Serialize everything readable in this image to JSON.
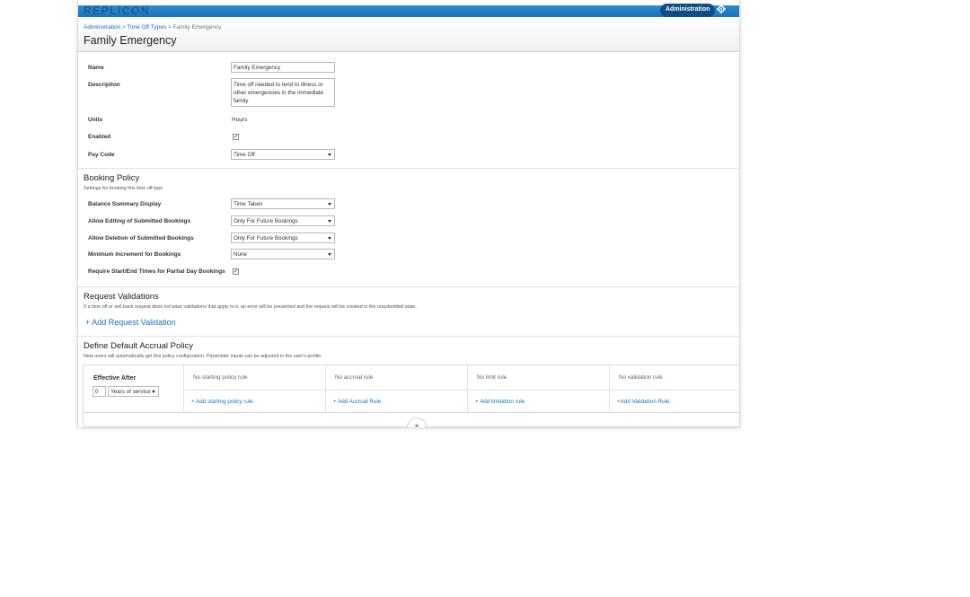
{
  "app": {
    "logo": "REPLICON",
    "admin_label": "Administration"
  },
  "breadcrumb": {
    "item1": "Administration",
    "sep1": " > ",
    "item2": "Time Off Types",
    "sep2": " > ",
    "current": "Family Emergency"
  },
  "page_title": "Family Emergency",
  "form": {
    "name_label": "Name",
    "name_value": "Family Emergency",
    "description_label": "Description",
    "description_value": "Time off needed to tend to illness or other emergencies in the immediate family",
    "units_label": "Units",
    "units_value": "Hours",
    "enabled_label": "Enabled",
    "enabled_checked": true,
    "paycode_label": "Pay Code",
    "paycode_value": "Time Off"
  },
  "booking": {
    "title": "Booking Policy",
    "subtitle": "Settings for booking this time off type",
    "balance_label": "Balance Summary Display",
    "balance_value": "Time Taken",
    "editing_label": "Allow Editing of Submitted Bookings",
    "editing_value": "Only For Future Bookings",
    "deletion_label": "Allow Deletion of Submitted Bookings",
    "deletion_value": "Only For Future Bookings",
    "increment_label": "Minimum Increment for Bookings",
    "increment_value": "None",
    "require_label": "Require Start/End Times for Partial Day Bookings",
    "require_checked": true
  },
  "validations": {
    "title": "Request Validations",
    "subtitle": "If a time off or sell back request does not pass validations that apply to it, an error will be presented and the request will be created in the unsubmitted state.",
    "add_label": "+ Add Request Validation"
  },
  "accrual": {
    "title": "Define Default Accrual Policy",
    "subtitle": "New users will automatically get this policy configuration. Parameter inputs can be adjusted in the user's profile.",
    "effective_label": "Effective After",
    "effective_value": "0",
    "effective_unit": "Years of service",
    "columns": [
      {
        "empty": "No starting policy rule",
        "link": "+ Add starting policy rule"
      },
      {
        "empty": "No accrual rule",
        "link": "+ Add Accrual Rule"
      },
      {
        "empty": "No limit rule",
        "link": "+ Add limitation rule"
      },
      {
        "empty": "No validation rule",
        "link": "+Add Validation Rule"
      }
    ],
    "add_row_symbol": "+"
  },
  "icons": {
    "settings": "gear-icon",
    "dropdown": "caret-down-icon",
    "check": "check-icon"
  },
  "colors": {
    "brand_blue": "#1b74b6",
    "admin_button": "#0f4e85",
    "link": "#1b74b6"
  }
}
